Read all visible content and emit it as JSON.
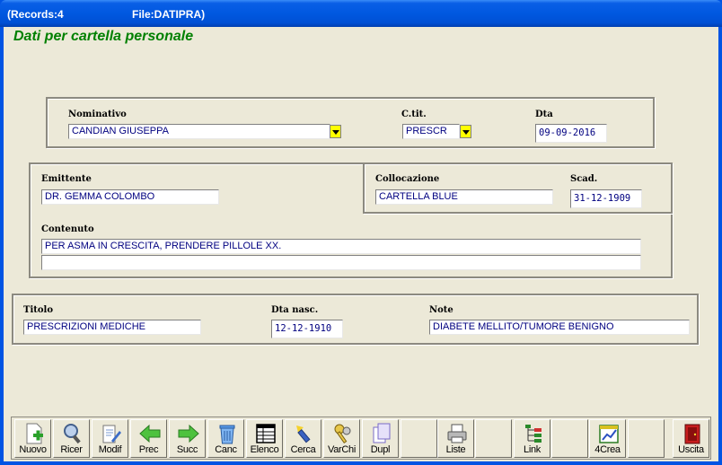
{
  "titlebar": {
    "records": "(Records:4",
    "file": "File:DATIPRA)"
  },
  "form": {
    "title": "Dati per cartella personale",
    "nominativo": {
      "label": "Nominativo",
      "value": "CANDIAN GIUSEPPA"
    },
    "ctit": {
      "label": "C.tit.",
      "value": "PRESCR"
    },
    "dta": {
      "label": "Dta",
      "value": "09-09-2016"
    },
    "emittente": {
      "label": "Emittente",
      "value": "DR. GEMMA COLOMBO"
    },
    "collocazione": {
      "label": "Collocazione",
      "value": "CARTELLA BLUE"
    },
    "scad": {
      "label": "Scad.",
      "value": "31-12-1909"
    },
    "contenuto": {
      "label": "Contenuto",
      "line1": "PER ASMA IN CRESCITA, PRENDERE PILLOLE XX.",
      "line2": ""
    },
    "titolo": {
      "label": "Titolo",
      "value": "PRESCRIZIONI MEDICHE"
    },
    "dta_nasc": {
      "label": "Dta nasc.",
      "value": "12-12-1910"
    },
    "note": {
      "label": "Note",
      "value": "DIABETE MELLITO/TUMORE BENIGNO"
    }
  },
  "toolbar": {
    "nuovo": "Nuovo",
    "ricer": "Ricer",
    "modif": "Modif",
    "prec": "Prec",
    "succ": "Succ",
    "canc": "Canc",
    "elenco": "Elenco",
    "cerca": "Cerca",
    "varchi": "VarChi",
    "dupl": "Dupl",
    "liste": "Liste",
    "link": "Link",
    "crea4": "4Crea",
    "uscita": "Uscita"
  },
  "colors": {
    "title_green": "#008000",
    "field_text": "#000080",
    "window_bg": "#ece9d8",
    "dropdown": "#ffff00"
  }
}
